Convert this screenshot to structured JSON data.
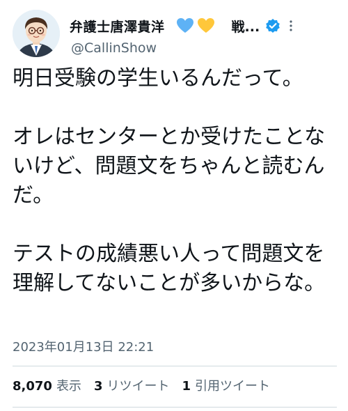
{
  "author": {
    "display_name": "弁護士唐澤貴洋",
    "truncated_name": "戦...",
    "handle": "@CallinShow",
    "icons": [
      "blue-heart-icon",
      "yellow-heart-icon",
      "verified-badge-icon",
      "more-options-icon"
    ]
  },
  "tweet": {
    "text": "明日受験の学生いるんだって。\n\nオレはセンターとか受けたことないけど、問題文をちゃんと読むんだ。\n\nテストの成績悪い人って問題文を理解してないことが多いからな。",
    "timestamp": "2023年01月13日 22:21"
  },
  "stats": {
    "views": {
      "count": "8,070",
      "label": "表示"
    },
    "retweets": {
      "count": "3",
      "label": "リツイート"
    },
    "quotes": {
      "count": "1",
      "label": "引用ツイート"
    }
  },
  "colors": {
    "verified_blue": "#1d9bf0",
    "heart_blue": "#5eb2f5",
    "heart_yellow": "#ffc73a",
    "secondary_text": "#536471"
  }
}
